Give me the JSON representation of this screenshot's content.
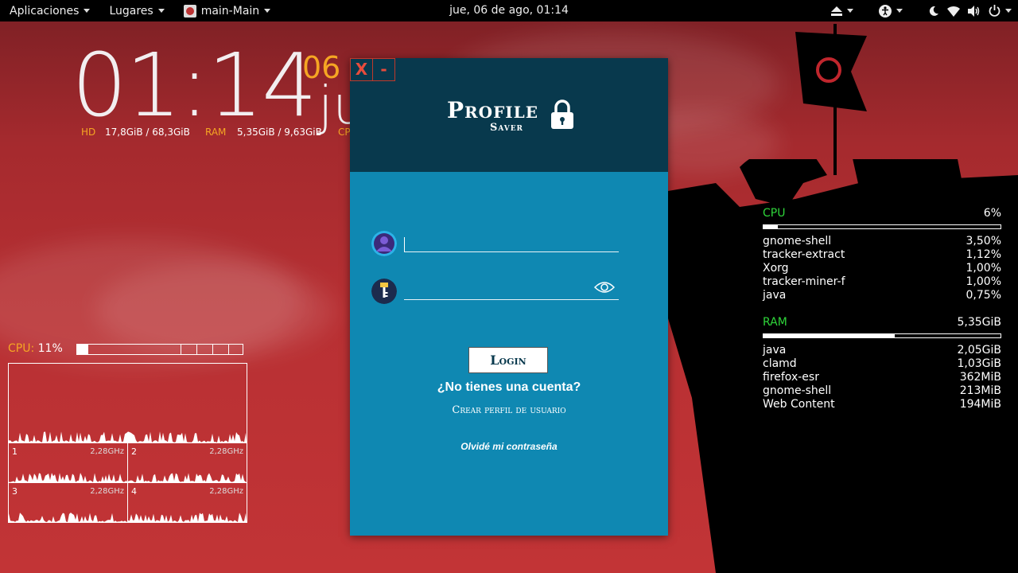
{
  "topbar": {
    "applications": "Aplicaciones",
    "places": "Lugares",
    "app_name": "main-Main",
    "datetime": "jue, 06 de ago, 01:14"
  },
  "clock_widget": {
    "time": "01:14",
    "day": "06",
    "month": "ju",
    "hd_label": "HD",
    "hd_value": "17,8GiB / 68,3GiB",
    "ram_label": "RAM",
    "ram_value": "5,35GiB / 9,63GiB",
    "cpu_label_cut": "CP"
  },
  "cpu_widget": {
    "label": "CPU:",
    "value": "11%",
    "usage_fraction": 0.11,
    "cores": [
      {
        "id": "1",
        "freq": "2,28GHz"
      },
      {
        "id": "2",
        "freq": "2,28GHz"
      },
      {
        "id": "3",
        "freq": "2,28GHz"
      },
      {
        "id": "4",
        "freq": "2,28GHz"
      }
    ]
  },
  "sysmon": {
    "cpu": {
      "label": "CPU",
      "value": "6%",
      "fraction": 0.06
    },
    "cpu_procs": [
      {
        "name": "gnome-shell",
        "value": "3,50%"
      },
      {
        "name": "tracker-extract",
        "value": "1,12%"
      },
      {
        "name": "Xorg",
        "value": "1,00%"
      },
      {
        "name": "tracker-miner-f",
        "value": "1,00%"
      },
      {
        "name": "java",
        "value": "0,75%"
      }
    ],
    "ram": {
      "label": "RAM",
      "value": "5,35GiB",
      "fraction": 0.555
    },
    "ram_procs": [
      {
        "name": "java",
        "value": "2,05GiB"
      },
      {
        "name": "clamd",
        "value": "1,03GiB"
      },
      {
        "name": "firefox-esr",
        "value": "362MiB"
      },
      {
        "name": "gnome-shell",
        "value": "213MiB"
      },
      {
        "name": "Web Content",
        "value": "194MiB"
      }
    ]
  },
  "login": {
    "close": "X",
    "minimize": "-",
    "logo_main": "Profile",
    "logo_sub": "Saver",
    "login_button": "Login",
    "no_account": "¿No tienes una cuenta?",
    "create_profile": "Crear perfil de usuario",
    "forgot_password": "Olvidé mi contraseña"
  },
  "colors": {
    "accent_orange": "#f5a623",
    "monitor_green": "#2fd63a",
    "window_header": "#08394d",
    "window_body": "#0f88b2",
    "close_red": "#e74c3c"
  }
}
